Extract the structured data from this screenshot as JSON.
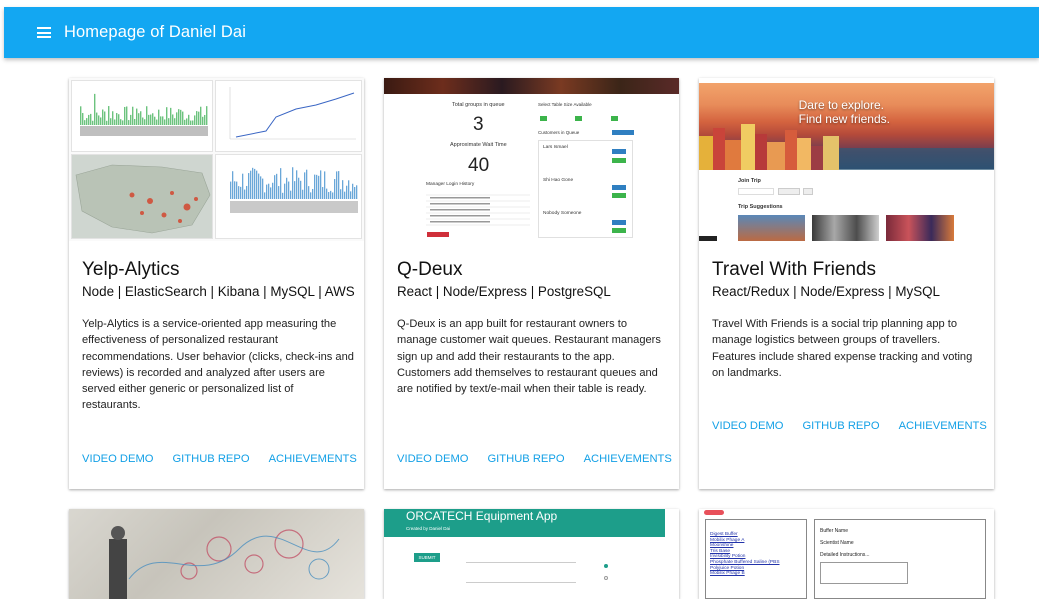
{
  "appbar": {
    "title": "Homepage of Daniel Dai",
    "menu_icon": "menu-icon"
  },
  "accent_color": "#13a7f2",
  "link_color": "#13a0e6",
  "cards": [
    {
      "title": "Yelp-Alytics",
      "stack": "Node | ElasticSearch | Kibana | MySQL | AWS",
      "description": "Yelp-Alytics is a service-oriented app measuring the effectiveness of personalized restaurant recommendations. User behavior (clicks, check-ins and reviews) is recorded and analyzed after users are served either generic or personalized list of restaurants.",
      "actions": [
        "VIDEO DEMO",
        "GITHUB REPO",
        "ACHIEVEMENTS"
      ]
    },
    {
      "title": "Q-Deux",
      "stack": "React | Node/Express | PostgreSQL",
      "description": "Q-Deux is an app built for restaurant owners to manage customer wait queues. Restaurant managers sign up and add their restaurants to the app. Customers add themselves to restaurant queues and are notified by text/e-mail when their table is ready.",
      "actions": [
        "VIDEO DEMO",
        "GITHUB REPO",
        "ACHIEVEMENTS"
      ],
      "screenshot": {
        "groups_label": "Total groups in queue",
        "groups_value": "3",
        "wait_label": "Approximate Wait Time",
        "wait_value": "40",
        "history_label": "Manager Login History",
        "table_size_label": "Select Table Size Available",
        "customers_label": "Customers in Queue",
        "customers": [
          "Lars Ismael",
          "Shi Hao Gone",
          "Nobody Someone"
        ]
      }
    },
    {
      "title": "Travel With Friends",
      "stack": "React/Redux | Node/Express | MySQL",
      "description": "Travel With Friends is a social trip planning app to manage logistics between groups of travellers. Features include shared expense tracking and voting on landmarks.",
      "actions": [
        "VIDEO DEMO",
        "GITHUB REPO",
        "ACHIEVEMENTS"
      ],
      "screenshot": {
        "hero_line1": "Dare to explore.",
        "hero_line2": "Find new friends.",
        "join_label": "Join Trip",
        "suggestions_label": "Trip Suggestions"
      }
    }
  ],
  "bottom_cards": {
    "orca": {
      "title": "ORCATECH Equipment App",
      "subtitle": "Created by Daniel Dai",
      "submit": "SUBMIT"
    },
    "lab": {
      "links": [
        "Digest Buffer",
        "Mobilix Phage A",
        "Moonshine",
        "Tris Base",
        "Invisibility Potion",
        "Phosphate Buffered Saline (PBS",
        "Polyjuice Potion",
        "Mobilix Phage B"
      ],
      "fields": [
        "Buffer Name",
        "Scientist Name",
        "Detailed Instructions..."
      ]
    }
  }
}
